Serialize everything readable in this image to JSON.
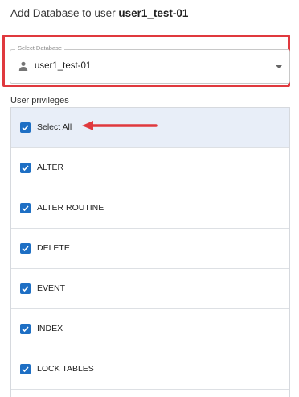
{
  "dialog": {
    "title_prefix": "Add Database to user",
    "title_user": "user1_test-01"
  },
  "select": {
    "legend": "Select Database",
    "value": "user1_test-01",
    "icon": "person-icon"
  },
  "privileges": {
    "label": "User privileges",
    "items": [
      {
        "label": "Select All",
        "checked": true
      },
      {
        "label": "ALTER",
        "checked": true
      },
      {
        "label": "ALTER ROUTINE",
        "checked": true
      },
      {
        "label": "DELETE",
        "checked": true
      },
      {
        "label": "EVENT",
        "checked": true
      },
      {
        "label": "INDEX",
        "checked": true
      },
      {
        "label": "LOCK TABLES",
        "checked": true
      }
    ]
  },
  "colors": {
    "highlight": "#e0393e",
    "checkbox": "#1e6fc4",
    "selected_row": "#e8eef8"
  }
}
